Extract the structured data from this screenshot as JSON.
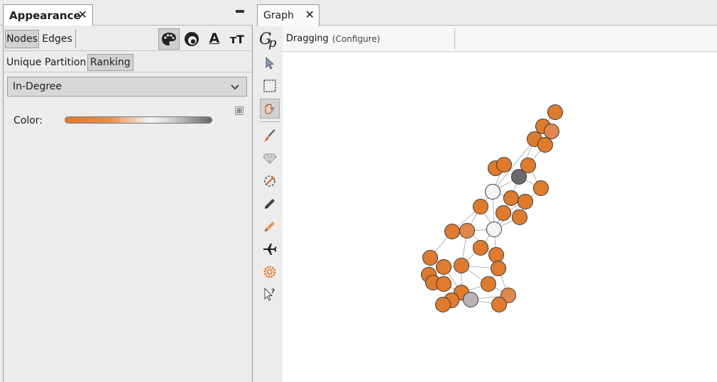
{
  "left_panel": {
    "tab_title": "Appearance",
    "close_glyph": "✕",
    "element_tabs": {
      "nodes": "Nodes",
      "edges": "Edges"
    },
    "tool_icons": [
      "palette-icon",
      "size-icon",
      "label-color-icon",
      "label-size-icon"
    ],
    "label_color_glyph": "A",
    "label_size_glyph": "тT",
    "sub_tabs": {
      "unique": "Unique",
      "partition": "Partition",
      "ranking": "Ranking"
    },
    "attribute_dropdown": {
      "selected": "In-Degree"
    },
    "color_label": "Color:",
    "gradient_colors": [
      "#e07a2c",
      "#f5f5f5",
      "#6a6668"
    ]
  },
  "right_panel": {
    "tab_title": "Graph",
    "close_glyph": "✕",
    "toolbar": {
      "mode": "Dragging",
      "configure": "(Configure)"
    },
    "sidebar_tools": [
      "select-icon",
      "rectangle-select-icon",
      "drag-icon",
      "painter-icon",
      "diamond-icon",
      "shortest-path-icon",
      "pencil-icon",
      "edge-pencil-icon",
      "airplane-icon",
      "gear-icon",
      "help-cursor-icon"
    ]
  },
  "graph": {
    "colors": {
      "orange": "#e07a2c",
      "light_orange": "#e0884a",
      "white": "#f4f4f4",
      "gray": "#b9b4b4",
      "dark": "#6b686b",
      "edge": "#9f9f9f"
    }
  }
}
